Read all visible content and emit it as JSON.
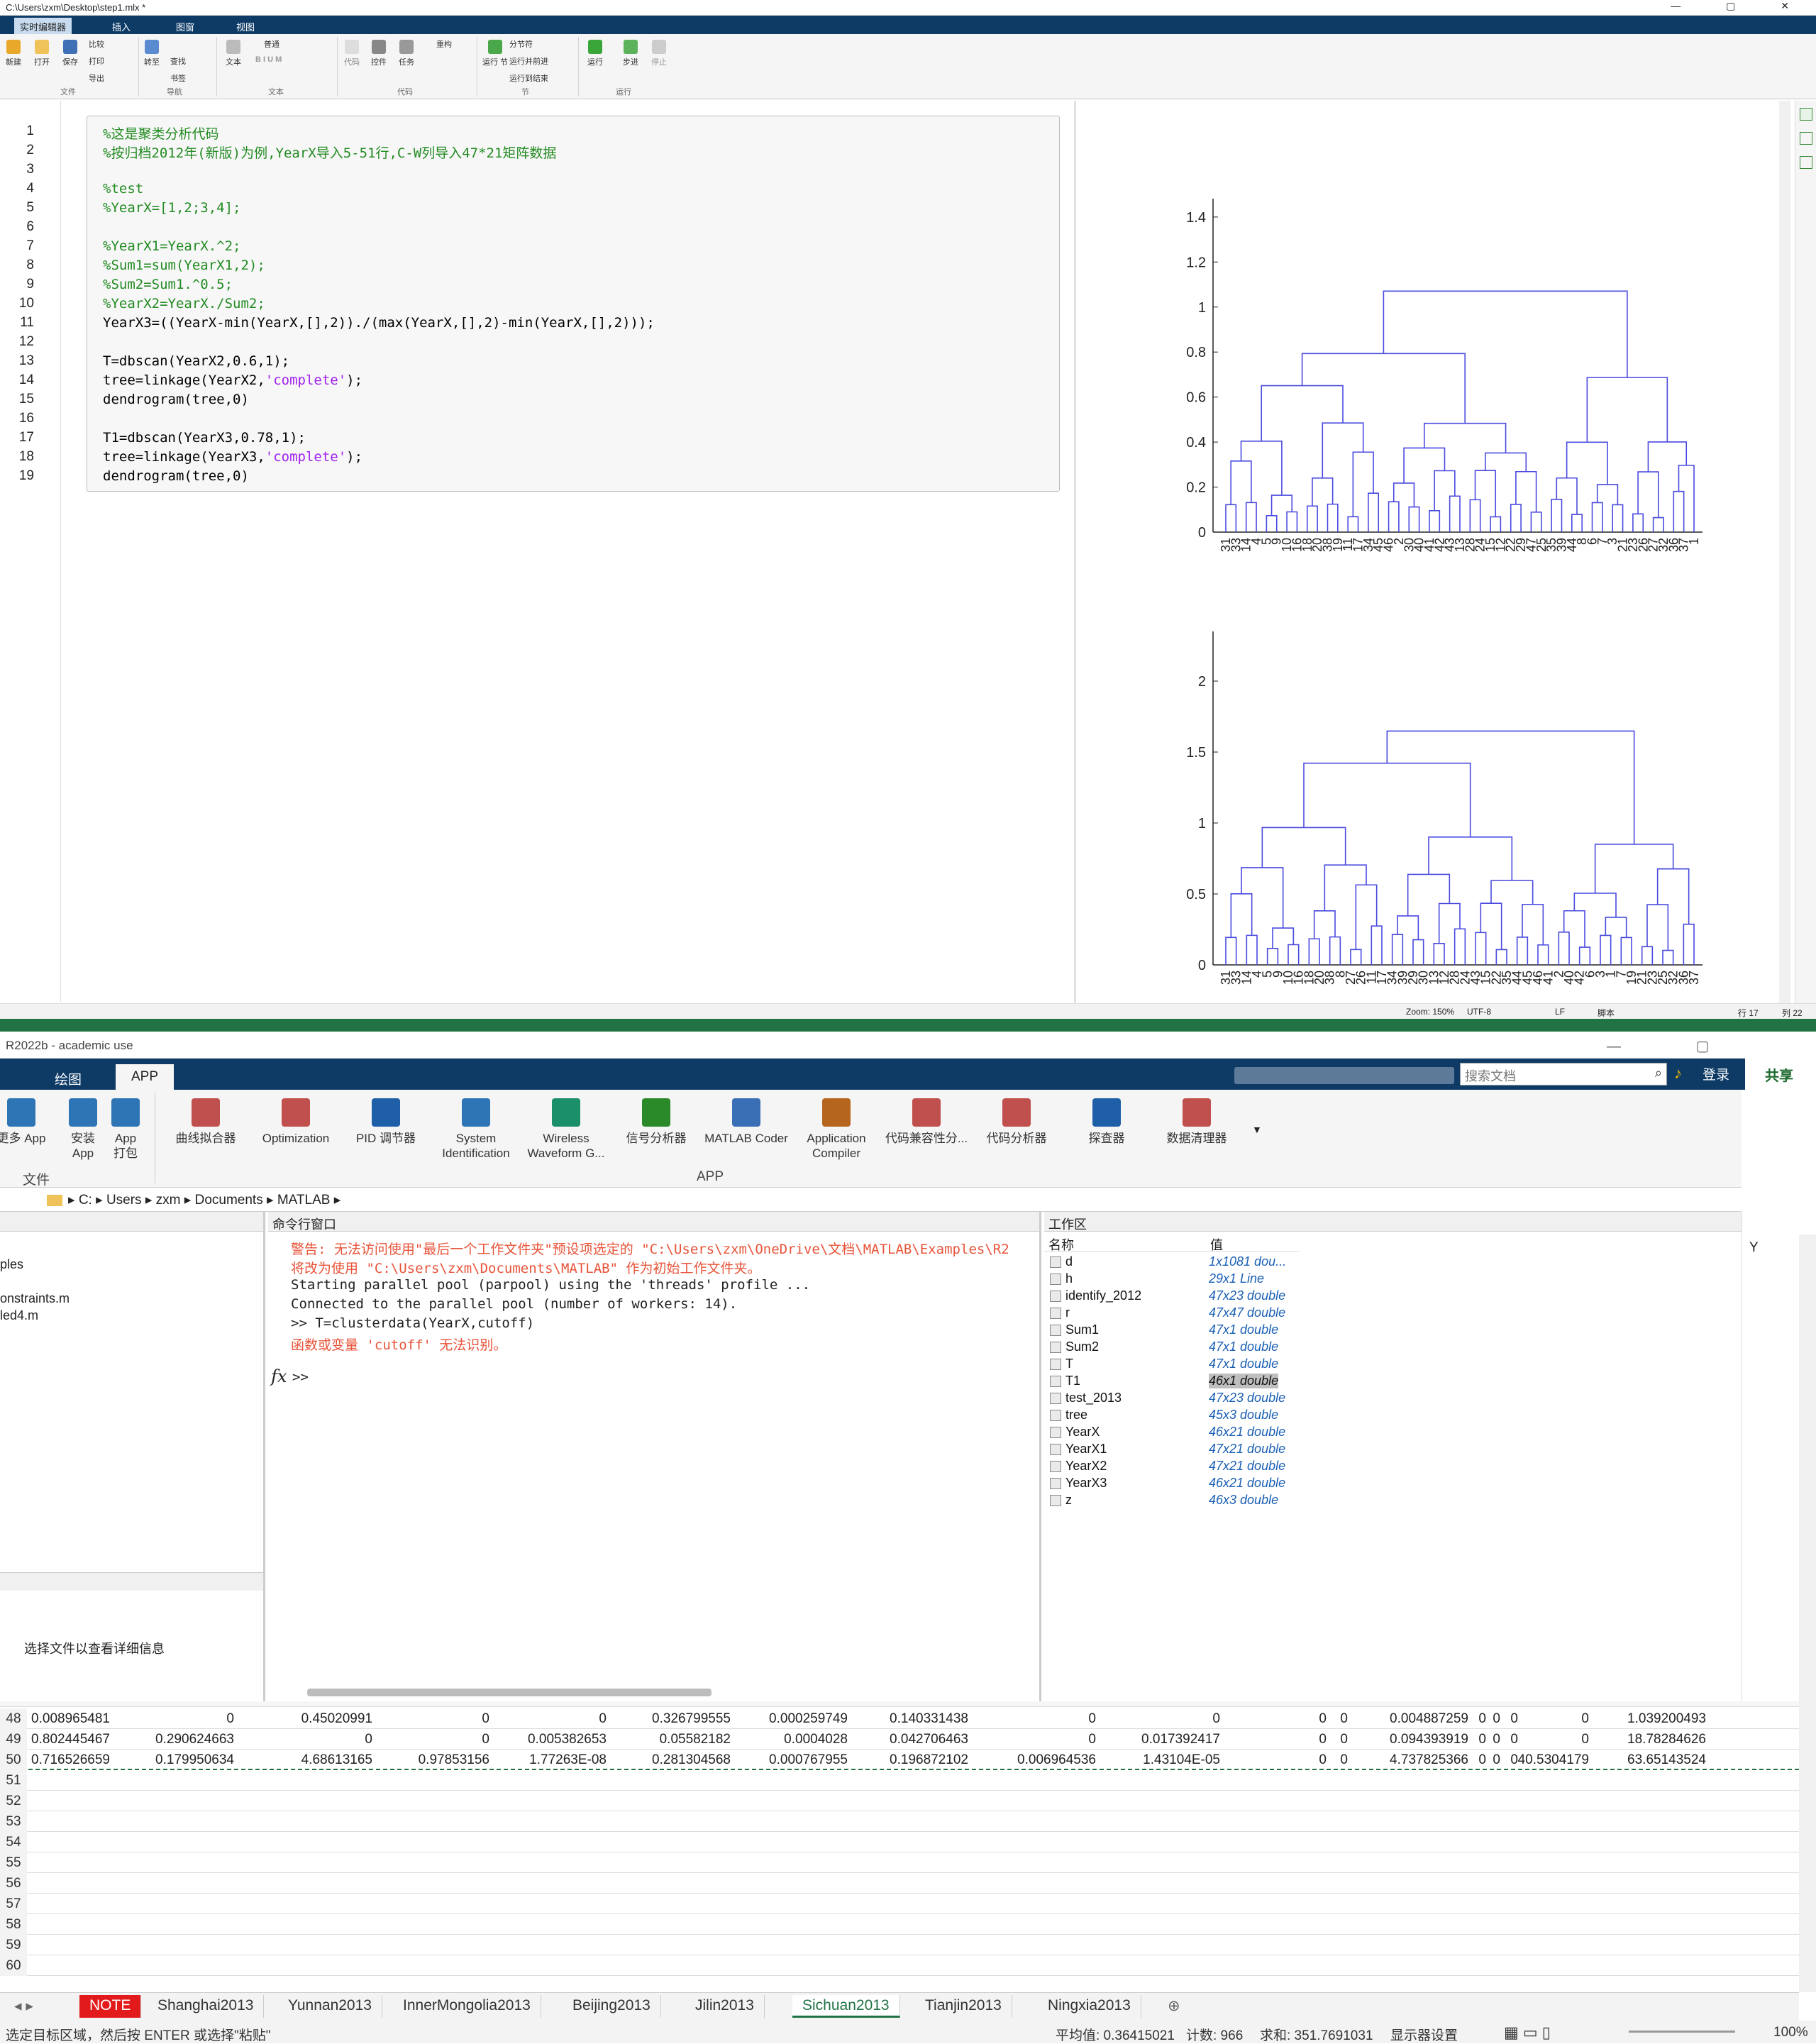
{
  "live_editor": {
    "title": "C:\\Users\\zxm\\Desktop\\step1.mlx *",
    "tabs": [
      "实时编辑器",
      "插入",
      "图窗",
      "视图"
    ],
    "ribbon": {
      "file": {
        "new": "新建",
        "open": "打开",
        "save": "保存",
        "compare": "比较",
        "print": "打印",
        "export": "导出",
        "group": "文件"
      },
      "nav": {
        "goto": "转至",
        "find": "查找",
        "bookmark": "书签",
        "group": "导航"
      },
      "text": {
        "text": "文本",
        "style": "普通",
        "group": "文本"
      },
      "code": {
        "code": "代码",
        "control": "控件",
        "task": "任务",
        "refactor": "重构",
        "group": "代码"
      },
      "section": {
        "run_section": "运行\n节",
        "section_break": "分节符",
        "run_advance": "运行并前进",
        "run_to_end": "运行到结束",
        "group": "节"
      },
      "run": {
        "run": "运行",
        "step": "步进",
        "stop": "停止",
        "group": "运行"
      }
    },
    "code_lines": [
      "%这是聚类分析代码",
      "%按归档2012年(新版)为例,YearX导入5-51行,C-W列导入47*21矩阵数据",
      "",
      "%test",
      "%YearX=[1,2;3,4];",
      "",
      "%YearX1=YearX.^2;",
      "%Sum1=sum(YearX1,2);",
      "%Sum2=Sum1.^0.5;",
      "%YearX2=YearX./Sum2;",
      "YearX3=((YearX-min(YearX,[],2))./(max(YearX,[],2)-min(YearX,[],2)));",
      "",
      "T=dbscan(YearX2,0.6,1);",
      "tree=linkage(YearX2,'complete');",
      "dendrogram(tree,0)",
      "",
      "T1=dbscan(YearX3,0.78,1);",
      "tree=linkage(YearX3,'complete');",
      "dendrogram(tree,0)"
    ],
    "status": {
      "zoom": "Zoom: 150%",
      "encoding": "UTF-8",
      "eol": "LF",
      "type": "脚本",
      "row": "行 17",
      "col": "列 22"
    }
  },
  "chart_data": [
    {
      "type": "dendrogram",
      "yticks": [
        "0",
        "0.2",
        "0.4",
        "0.6",
        "0.8",
        "1",
        "1.2",
        "1.4"
      ],
      "ylim": [
        0,
        1.45
      ],
      "leaves": [
        "31",
        "33",
        "14",
        "4",
        "5",
        "9",
        "10",
        "16",
        "18",
        "20",
        "38",
        "19",
        "11",
        "17",
        "34",
        "45",
        "46",
        "2",
        "30",
        "40",
        "41",
        "42",
        "43",
        "13",
        "28",
        "24",
        "15",
        "12",
        "22",
        "29",
        "47",
        "25",
        "35",
        "39",
        "44",
        "8",
        "6",
        "7",
        "3",
        "21",
        "23",
        "26",
        "27",
        "32",
        "36",
        "37",
        "1"
      ],
      "link_color": "#4a4adf"
    },
    {
      "type": "dendrogram",
      "yticks": [
        "0",
        "0.5",
        "1",
        "1.5",
        "2"
      ],
      "ylim": [
        0,
        2.3
      ],
      "leaves": [
        "31",
        "33",
        "14",
        "4",
        "5",
        "9",
        "10",
        "16",
        "18",
        "20",
        "38",
        "8",
        "27",
        "26",
        "11",
        "17",
        "34",
        "39",
        "29",
        "30",
        "13",
        "12",
        "28",
        "24",
        "43",
        "15",
        "22",
        "35",
        "44",
        "45",
        "46",
        "41",
        "2",
        "40",
        "42",
        "6",
        "3",
        "1",
        "7",
        "19",
        "21",
        "23",
        "25",
        "32",
        "36",
        "37"
      ],
      "link_color": "#4a4adf"
    }
  ],
  "matlab": {
    "title": "R2022b - academic use",
    "tabs": [
      "绘图",
      "APP"
    ],
    "search_placeholder": "搜索文档",
    "login": "登录",
    "share": "共享",
    "apps": [
      {
        "label": "曲线拟合器",
        "icon": "curve-fitter-icon",
        "color": "#c0504d"
      },
      {
        "label": "Optimization",
        "icon": "optimization-icon",
        "color": "#c0504d"
      },
      {
        "label": "PID 调节器",
        "icon": "pid-tuner-icon",
        "color": "#1f5fa8"
      },
      {
        "label": "System\nIdentification",
        "icon": "system-id-icon",
        "color": "#2e75b6"
      },
      {
        "label": "Wireless\nWaveform G...",
        "icon": "wireless-icon",
        "color": "#1a8f6a"
      },
      {
        "label": "信号分析器",
        "icon": "signal-analyzer-icon",
        "color": "#2a8a2a"
      },
      {
        "label": "MATLAB Coder",
        "icon": "matlab-coder-icon",
        "color": "#3a6fb5"
      },
      {
        "label": "Application\nCompiler",
        "icon": "app-compiler-icon",
        "color": "#b5651d"
      },
      {
        "label": "代码兼容性分...",
        "icon": "code-compat-icon",
        "color": "#c0504d"
      },
      {
        "label": "代码分析器",
        "icon": "code-analyzer-icon",
        "color": "#c0504d"
      },
      {
        "label": "探查器",
        "icon": "profiler-icon",
        "color": "#1f5fa8"
      },
      {
        "label": "数据清理器",
        "icon": "data-cleaner-icon",
        "color": "#c0504d"
      }
    ],
    "left_apps": [
      {
        "label": "更多 App"
      },
      {
        "label": "安装\nApp"
      },
      {
        "label": "App\n打包"
      }
    ],
    "ribbon_group_file": "文件",
    "ribbon_group_app": "APP",
    "address": [
      "C:",
      "Users",
      "zxm",
      "Documents",
      "MATLAB"
    ],
    "file_browser": {
      "items": [
        "ples",
        "onstraints.m",
        "led4.m"
      ],
      "detail_hint": "选择文件以查看详细信息"
    },
    "command_window": {
      "title": "命令行窗口",
      "lines": [
        {
          "text": "警告: 无法访问使用\"最后一个工作文件夹\"预设项选定的 \"C:\\Users\\zxm\\OneDrive\\文档\\MATLAB\\Examples\\R2",
          "kind": "warn"
        },
        {
          "text": "将改为使用 \"C:\\Users\\zxm\\Documents\\MATLAB\" 作为初始工作文件夹。",
          "kind": "warn"
        },
        {
          "text": "Starting parallel pool (parpool) using the 'threads' profile ...",
          "kind": "normal"
        },
        {
          "text": "Connected to the parallel pool (number of workers: 14).",
          "kind": "normal"
        },
        {
          "text": ">> T=clusterdata(YearX,cutoff)",
          "kind": "normal"
        },
        {
          "text": "函数或变量 'cutoff' 无法识别。",
          "kind": "warn"
        }
      ],
      "prompt": ">>"
    },
    "workspace": {
      "title": "工作区",
      "col_name": "名称",
      "col_value": "值",
      "vars": [
        {
          "name": "d",
          "value": "1x1081 dou..."
        },
        {
          "name": "h",
          "value": "29x1 Line"
        },
        {
          "name": "identify_2012",
          "value": "47x23 double"
        },
        {
          "name": "r",
          "value": "47x47 double"
        },
        {
          "name": "Sum1",
          "value": "47x1 double"
        },
        {
          "name": "Sum2",
          "value": "47x1 double"
        },
        {
          "name": "T",
          "value": "47x1 double"
        },
        {
          "name": "T1",
          "value": "46x1 double"
        },
        {
          "name": "test_2013",
          "value": "47x23 double"
        },
        {
          "name": "tree",
          "value": "45x3 double"
        },
        {
          "name": "YearX",
          "value": "46x21 double"
        },
        {
          "name": "YearX1",
          "value": "47x21 double"
        },
        {
          "name": "YearX2",
          "value": "47x21 double"
        },
        {
          "name": "YearX3",
          "value": "46x21 double"
        },
        {
          "name": "z",
          "value": "46x3 double"
        }
      ]
    }
  },
  "excel": {
    "rows": [
      {
        "n": "48",
        "cells": [
          "0.008965481",
          "0",
          "0.45020991",
          "0",
          "0",
          "0.326799555",
          "0.000259749",
          "0.140331438",
          "0",
          "0",
          "0",
          "0",
          "0.004887259",
          "0",
          "0",
          "0",
          "0",
          "1.039200493"
        ]
      },
      {
        "n": "49",
        "cells": [
          "0.802445467",
          "0.290624663",
          "0",
          "0",
          "0.005382653",
          "0.05582182",
          "0.0004028",
          "0.042706463",
          "0",
          "0.017392417",
          "0",
          "0",
          "0.094393919",
          "0",
          "0",
          "0",
          "0",
          "18.78284626"
        ]
      },
      {
        "n": "50",
        "cells": [
          "0.716526659",
          "0.179950634",
          "4.68613165",
          "0.97853156",
          "1.77263E-08",
          "0.281304568",
          "0.000767955",
          "0.196872102",
          "0.006964536",
          "1.43104E-05",
          "0",
          "0",
          "4.737825366",
          "0",
          "0",
          "0",
          "40.5304179",
          "63.65143524"
        ]
      },
      {
        "n": "51",
        "cells": []
      },
      {
        "n": "52",
        "cells": []
      },
      {
        "n": "53",
        "cells": []
      },
      {
        "n": "54",
        "cells": []
      },
      {
        "n": "55",
        "cells": []
      },
      {
        "n": "56",
        "cells": []
      },
      {
        "n": "57",
        "cells": []
      },
      {
        "n": "58",
        "cells": []
      },
      {
        "n": "59",
        "cells": []
      },
      {
        "n": "60",
        "cells": []
      }
    ],
    "col_y_header": "Y",
    "sheets": [
      "NOTE",
      "Shanghai2013",
      "Yunnan2013",
      "InnerMongolia2013",
      "Beijing2013",
      "Jilin2013",
      "Sichuan2013",
      "Tianjin2013",
      "Ningxia2013"
    ],
    "active_sheet": "Sichuan2013",
    "status": {
      "hint": "选定目标区域，然后按 ENTER 或选择\"粘贴\"",
      "avg": "平均值: 0.36415021",
      "count": "计数: 966",
      "sum": "求和: 351.7691031",
      "display": "显示器设置",
      "zoom": "100%"
    }
  }
}
